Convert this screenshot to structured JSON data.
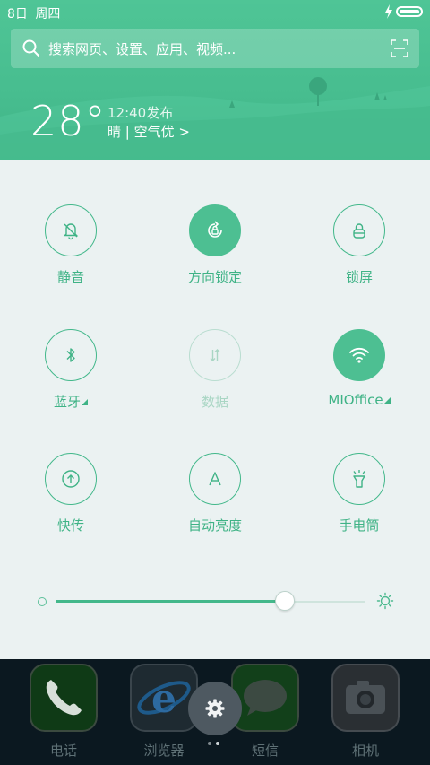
{
  "status_bar": {
    "date": "8日",
    "weekday": "周四"
  },
  "search": {
    "placeholder": "搜索网页、设置、应用、视频..."
  },
  "weather": {
    "temperature": "28°",
    "published": "12:40发布",
    "condition": "晴 | 空气优 >"
  },
  "toggles": [
    {
      "label": "静音",
      "icon": "bell-off-icon",
      "state": "off"
    },
    {
      "label": "方向锁定",
      "icon": "rotation-lock-icon",
      "state": "on"
    },
    {
      "label": "锁屏",
      "icon": "lock-icon",
      "state": "off"
    },
    {
      "label": "蓝牙",
      "icon": "bluetooth-icon",
      "state": "off",
      "has_menu": true
    },
    {
      "label": "数据",
      "icon": "mobile-data-icon",
      "state": "disabled"
    },
    {
      "label": "MIOffice",
      "icon": "wifi-icon",
      "state": "on",
      "has_menu": true
    },
    {
      "label": "快传",
      "icon": "share-upload-icon",
      "state": "off"
    },
    {
      "label": "自动亮度",
      "icon": "auto-brightness-icon",
      "state": "off"
    },
    {
      "label": "手电筒",
      "icon": "flashlight-icon",
      "state": "off"
    }
  ],
  "brightness": {
    "level": 0.74
  },
  "dock": {
    "apps": [
      {
        "label": "电话",
        "icon": "phone-icon"
      },
      {
        "label": "浏览器",
        "icon": "browser-icon"
      },
      {
        "label": "短信",
        "icon": "message-icon"
      },
      {
        "label": "相机",
        "icon": "camera-icon"
      }
    ],
    "page_count": 2,
    "current_page": 2
  },
  "colors": {
    "accent": "#4dbf92",
    "panel_bg": "#ebf2f2",
    "header_bg": "#47bd8f"
  }
}
